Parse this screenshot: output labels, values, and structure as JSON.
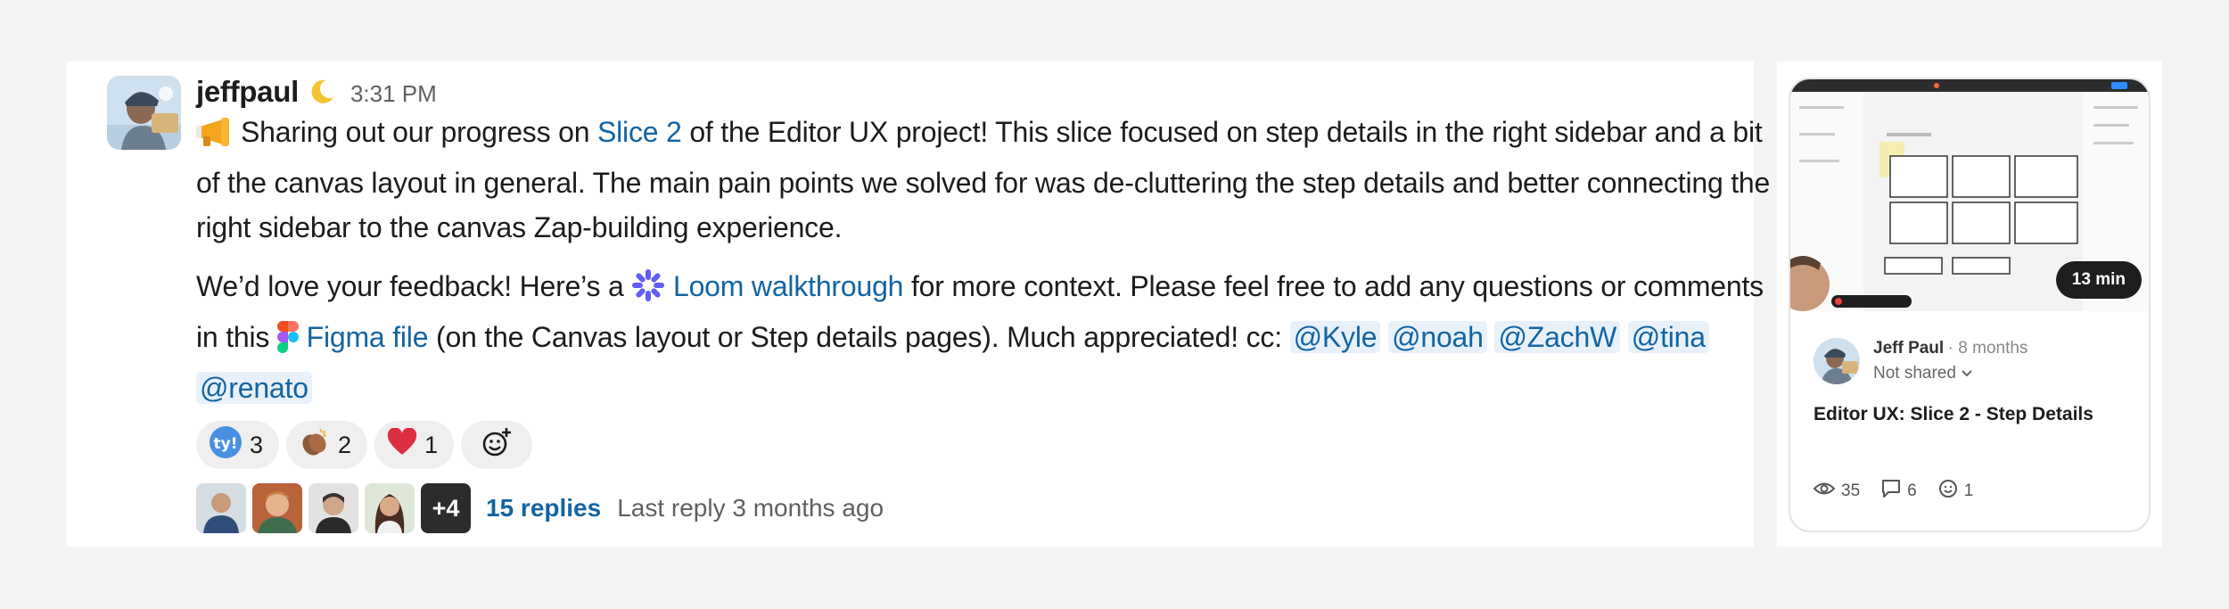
{
  "message": {
    "username": "jeffpaul",
    "status_emoji": "crescent-moon-icon",
    "timestamp": "3:31 PM",
    "paragraph1": {
      "emoji": "megaphone-icon",
      "part1": "Sharing out our progress on ",
      "link": "Slice 2",
      "part2": " of the Editor UX project! This slice focused on step details in the right sidebar and a bit of the canvas layout in general. The main pain points we solved for was de-cluttering the step details and better connecting the right sidebar to the canvas Zap-building experience."
    },
    "paragraph2": {
      "part1": "We’d love your feedback! Here’s a ",
      "loom_icon": "loom-icon",
      "loom_link": "Loom walkthrough",
      "part2": " for more context. Please feel free to add any questions or comments in this ",
      "figma_icon": "figma-icon",
      "figma_link": "Figma file",
      "part3": " (on the Canvas layout or Step details pages). Much appreciated! cc: ",
      "mentions": [
        "@Kyle",
        "@noah",
        "@ZachW",
        "@tina",
        "@renato"
      ]
    },
    "reactions": [
      {
        "emoji": "ty-icon",
        "count": "3"
      },
      {
        "emoji": "clapping-hands-icon",
        "count": "2"
      },
      {
        "emoji": "red-heart-icon",
        "count": "1"
      }
    ],
    "add_reaction_icon": "add-reaction-icon",
    "thread": {
      "more_count": "+4",
      "replies": "15 replies",
      "last_reply": "Last reply 3 months ago"
    }
  },
  "loom_card": {
    "duration": "13 min",
    "author": "Jeff Paul",
    "age": "8 months",
    "share_status": "Not shared",
    "title": "Editor UX: Slice 2 - Step Details",
    "views": "35",
    "comments": "6",
    "reactions": "1"
  },
  "colors": {
    "link": "#1264a3",
    "mention_bg": "#e8f1f9",
    "background": "#f4f4f4"
  }
}
